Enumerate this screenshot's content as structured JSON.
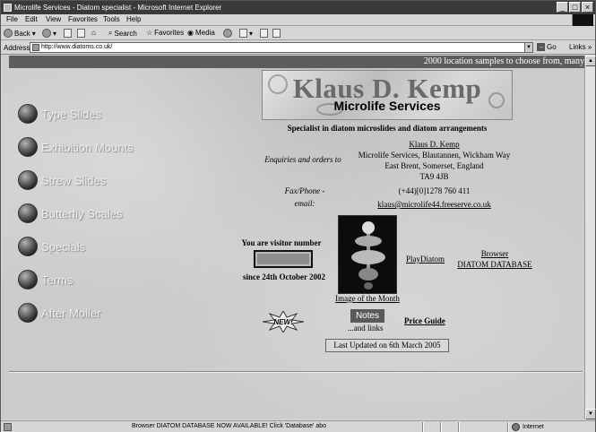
{
  "window": {
    "title": "Microlife Services - Diatom specialist - Microsoft Internet Explorer"
  },
  "menu": [
    "File",
    "Edit",
    "View",
    "Favorites",
    "Tools",
    "Help"
  ],
  "toolbar": {
    "back": "Back",
    "search": "Search",
    "favorites": "Favorites",
    "media": "Media"
  },
  "address": {
    "label": "Address",
    "url": "http://www.diatoms.co.uk/",
    "go": "Go",
    "links": "Links"
  },
  "marquee": "2000 location samples to choose from, many",
  "nav": [
    {
      "label": "Type Slides"
    },
    {
      "label": "Exhibition Mounts"
    },
    {
      "label": "Strew Slides"
    },
    {
      "label": "Butterfly Scales"
    },
    {
      "label": "Specials"
    },
    {
      "label": "Terms"
    },
    {
      "label": "After Moller"
    }
  ],
  "logo": {
    "name": "Klaus D. Kemp",
    "sub": "Microlife Services"
  },
  "tagline": "Specialist in diatom microslides and diatom arrangements",
  "enquiries": {
    "label": "Enquiries and orders to",
    "name": "Klaus D. Kemp",
    "line1": "Microlife Services, Blautannen, Wickham Way",
    "line2": "East Brent, Somerset, England",
    "line3": "TA9 4JB"
  },
  "contact": {
    "label1": "Fax/Phone -",
    "label2": "email:",
    "phone": "(+44)[0]1278 760 411",
    "email": "klaus@microlife44.freeserve.co.uk"
  },
  "visitor": {
    "title": "You are visitor number",
    "since": "since 24th October 2002"
  },
  "image_of_month": "Image of the Month",
  "play_diatom": "PlayDiatom",
  "browser": {
    "line1": "Browser",
    "line2": "DIATOM DATABASE"
  },
  "new_badge": "NEW!",
  "notes": {
    "label": "Notes",
    "sub": "...and links"
  },
  "price_guide": "Price Guide",
  "updated": "Last Updated on 6th March 2005",
  "status": {
    "text": "Browser DIATOM DATABASE NOW AVAILABLE! Click 'Database' abo",
    "zone": "Internet"
  }
}
